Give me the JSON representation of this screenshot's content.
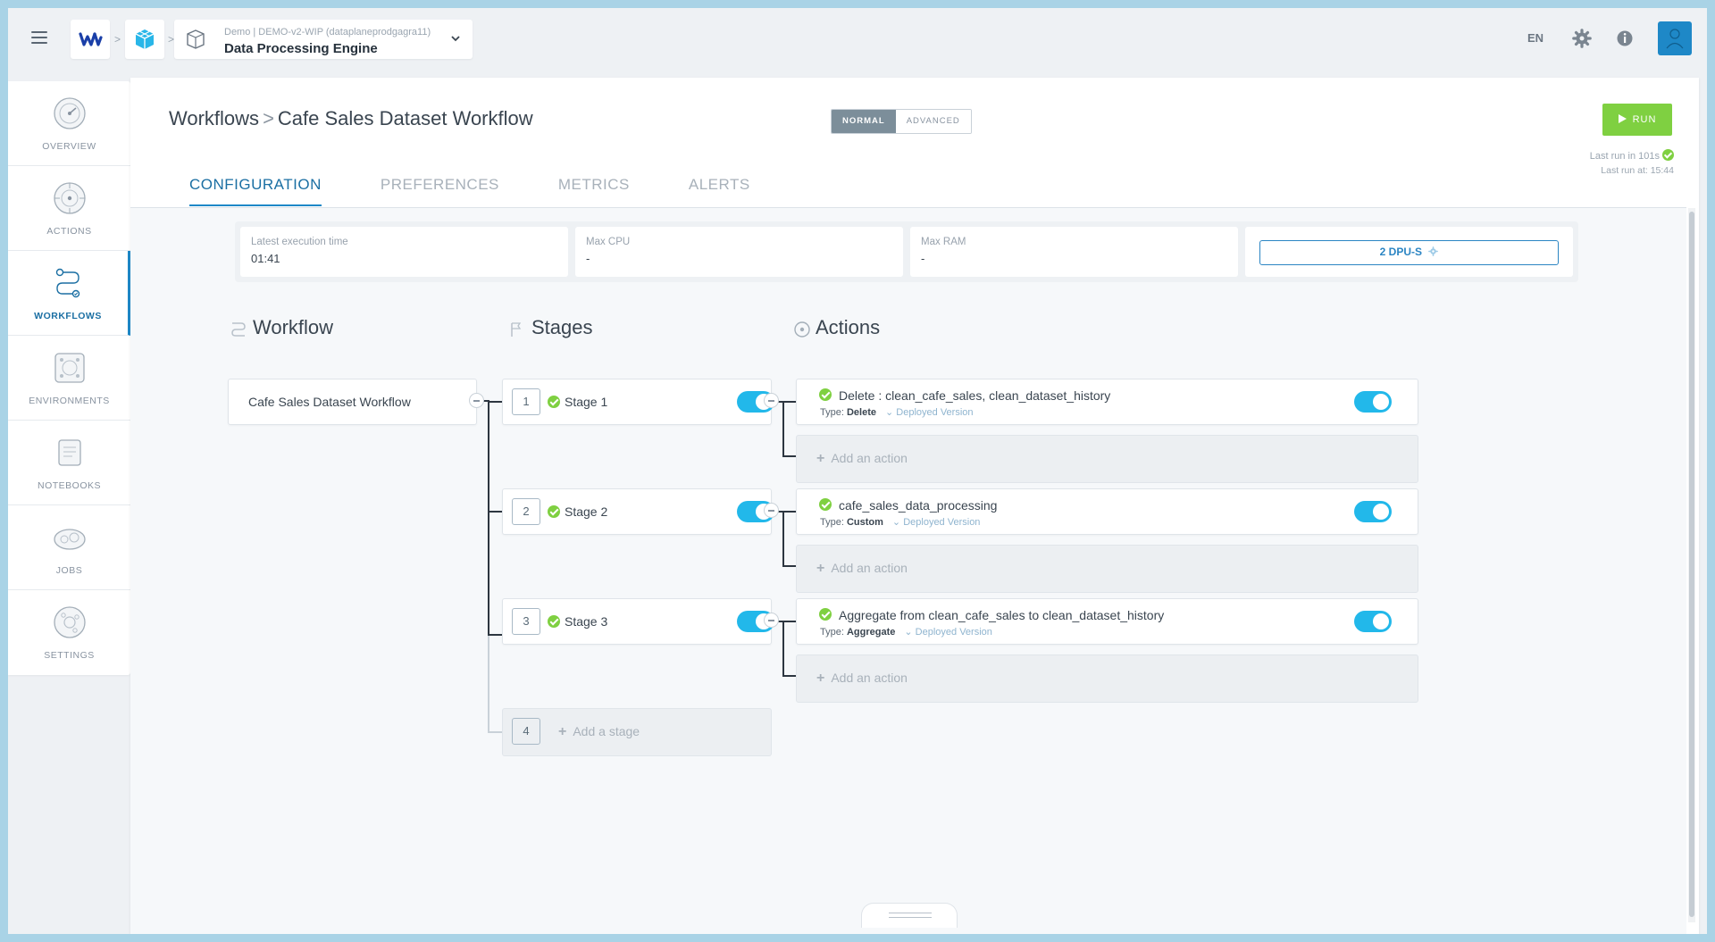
{
  "topbar": {
    "project_sub": "Demo | DEMO-v2-WIP (dataplaneprodgagra11)",
    "project_title": "Data Processing Engine",
    "lang": "EN"
  },
  "nav": {
    "items": [
      {
        "label": "OVERVIEW",
        "icon": "gauge-icon"
      },
      {
        "label": "ACTIONS",
        "icon": "target-icon"
      },
      {
        "label": "WORKFLOWS",
        "icon": "workflow-icon"
      },
      {
        "label": "ENVIRONMENTS",
        "icon": "cluster-icon"
      },
      {
        "label": "NOTEBOOKS",
        "icon": "notebook-icon"
      },
      {
        "label": "JOBS",
        "icon": "jobs-icon"
      },
      {
        "label": "SETTINGS",
        "icon": "settings-icon"
      }
    ]
  },
  "header": {
    "breadcrumb_root": "Workflows",
    "breadcrumb_current": "Cafe Sales Dataset Workflow",
    "mode_normal": "NORMAL",
    "mode_advanced": "ADVANCED",
    "run_label": "RUN",
    "last_run": "Last run in 101s",
    "last_run_at": "Last run at: 15:44"
  },
  "tabs": [
    "CONFIGURATION",
    "PREFERENCES",
    "METRICS",
    "ALERTS"
  ],
  "metrics": {
    "exec_label": "Latest execution time",
    "exec_value": "01:41",
    "cpu_label": "Max CPU",
    "cpu_value": "-",
    "ram_label": "Max RAM",
    "ram_value": "-",
    "dpu_label": "2 DPU-S"
  },
  "columns": {
    "workflow": "Workflow",
    "stages": "Stages",
    "actions": "Actions"
  },
  "workflow_name": "Cafe Sales Dataset Workflow",
  "stages": [
    {
      "num": "1",
      "name": "Stage 1"
    },
    {
      "num": "2",
      "name": "Stage 2"
    },
    {
      "num": "3",
      "name": "Stage 3"
    }
  ],
  "add_stage": {
    "num": "4",
    "label": "Add a stage"
  },
  "actions": [
    {
      "title": "Delete : clean_cafe_sales, clean_dataset_history",
      "type_label": "Type:",
      "type": "Delete",
      "version": "Deployed Version"
    },
    {
      "title": "cafe_sales_data_processing",
      "type_label": "Type:",
      "type": "Custom",
      "version": "Deployed Version"
    },
    {
      "title": "Aggregate from clean_cafe_sales to clean_dataset_history",
      "type_label": "Type:",
      "type": "Aggregate",
      "version": "Deployed Version"
    }
  ],
  "add_action_label": "Add an action"
}
